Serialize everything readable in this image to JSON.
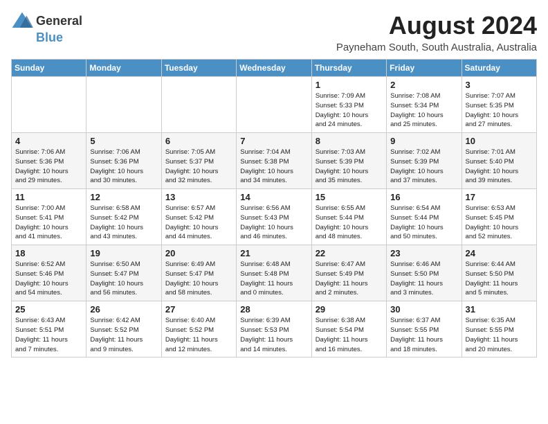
{
  "header": {
    "logo_general": "General",
    "logo_blue": "Blue",
    "month_title": "August 2024",
    "location": "Payneham South, South Australia, Australia"
  },
  "days_of_week": [
    "Sunday",
    "Monday",
    "Tuesday",
    "Wednesday",
    "Thursday",
    "Friday",
    "Saturday"
  ],
  "weeks": [
    [
      {
        "day": "",
        "info": ""
      },
      {
        "day": "",
        "info": ""
      },
      {
        "day": "",
        "info": ""
      },
      {
        "day": "",
        "info": ""
      },
      {
        "day": "1",
        "info": "Sunrise: 7:09 AM\nSunset: 5:33 PM\nDaylight: 10 hours\nand 24 minutes."
      },
      {
        "day": "2",
        "info": "Sunrise: 7:08 AM\nSunset: 5:34 PM\nDaylight: 10 hours\nand 25 minutes."
      },
      {
        "day": "3",
        "info": "Sunrise: 7:07 AM\nSunset: 5:35 PM\nDaylight: 10 hours\nand 27 minutes."
      }
    ],
    [
      {
        "day": "4",
        "info": "Sunrise: 7:06 AM\nSunset: 5:36 PM\nDaylight: 10 hours\nand 29 minutes."
      },
      {
        "day": "5",
        "info": "Sunrise: 7:06 AM\nSunset: 5:36 PM\nDaylight: 10 hours\nand 30 minutes."
      },
      {
        "day": "6",
        "info": "Sunrise: 7:05 AM\nSunset: 5:37 PM\nDaylight: 10 hours\nand 32 minutes."
      },
      {
        "day": "7",
        "info": "Sunrise: 7:04 AM\nSunset: 5:38 PM\nDaylight: 10 hours\nand 34 minutes."
      },
      {
        "day": "8",
        "info": "Sunrise: 7:03 AM\nSunset: 5:39 PM\nDaylight: 10 hours\nand 35 minutes."
      },
      {
        "day": "9",
        "info": "Sunrise: 7:02 AM\nSunset: 5:39 PM\nDaylight: 10 hours\nand 37 minutes."
      },
      {
        "day": "10",
        "info": "Sunrise: 7:01 AM\nSunset: 5:40 PM\nDaylight: 10 hours\nand 39 minutes."
      }
    ],
    [
      {
        "day": "11",
        "info": "Sunrise: 7:00 AM\nSunset: 5:41 PM\nDaylight: 10 hours\nand 41 minutes."
      },
      {
        "day": "12",
        "info": "Sunrise: 6:58 AM\nSunset: 5:42 PM\nDaylight: 10 hours\nand 43 minutes."
      },
      {
        "day": "13",
        "info": "Sunrise: 6:57 AM\nSunset: 5:42 PM\nDaylight: 10 hours\nand 44 minutes."
      },
      {
        "day": "14",
        "info": "Sunrise: 6:56 AM\nSunset: 5:43 PM\nDaylight: 10 hours\nand 46 minutes."
      },
      {
        "day": "15",
        "info": "Sunrise: 6:55 AM\nSunset: 5:44 PM\nDaylight: 10 hours\nand 48 minutes."
      },
      {
        "day": "16",
        "info": "Sunrise: 6:54 AM\nSunset: 5:44 PM\nDaylight: 10 hours\nand 50 minutes."
      },
      {
        "day": "17",
        "info": "Sunrise: 6:53 AM\nSunset: 5:45 PM\nDaylight: 10 hours\nand 52 minutes."
      }
    ],
    [
      {
        "day": "18",
        "info": "Sunrise: 6:52 AM\nSunset: 5:46 PM\nDaylight: 10 hours\nand 54 minutes."
      },
      {
        "day": "19",
        "info": "Sunrise: 6:50 AM\nSunset: 5:47 PM\nDaylight: 10 hours\nand 56 minutes."
      },
      {
        "day": "20",
        "info": "Sunrise: 6:49 AM\nSunset: 5:47 PM\nDaylight: 10 hours\nand 58 minutes."
      },
      {
        "day": "21",
        "info": "Sunrise: 6:48 AM\nSunset: 5:48 PM\nDaylight: 11 hours\nand 0 minutes."
      },
      {
        "day": "22",
        "info": "Sunrise: 6:47 AM\nSunset: 5:49 PM\nDaylight: 11 hours\nand 2 minutes."
      },
      {
        "day": "23",
        "info": "Sunrise: 6:46 AM\nSunset: 5:50 PM\nDaylight: 11 hours\nand 3 minutes."
      },
      {
        "day": "24",
        "info": "Sunrise: 6:44 AM\nSunset: 5:50 PM\nDaylight: 11 hours\nand 5 minutes."
      }
    ],
    [
      {
        "day": "25",
        "info": "Sunrise: 6:43 AM\nSunset: 5:51 PM\nDaylight: 11 hours\nand 7 minutes."
      },
      {
        "day": "26",
        "info": "Sunrise: 6:42 AM\nSunset: 5:52 PM\nDaylight: 11 hours\nand 9 minutes."
      },
      {
        "day": "27",
        "info": "Sunrise: 6:40 AM\nSunset: 5:52 PM\nDaylight: 11 hours\nand 12 minutes."
      },
      {
        "day": "28",
        "info": "Sunrise: 6:39 AM\nSunset: 5:53 PM\nDaylight: 11 hours\nand 14 minutes."
      },
      {
        "day": "29",
        "info": "Sunrise: 6:38 AM\nSunset: 5:54 PM\nDaylight: 11 hours\nand 16 minutes."
      },
      {
        "day": "30",
        "info": "Sunrise: 6:37 AM\nSunset: 5:55 PM\nDaylight: 11 hours\nand 18 minutes."
      },
      {
        "day": "31",
        "info": "Sunrise: 6:35 AM\nSunset: 5:55 PM\nDaylight: 11 hours\nand 20 minutes."
      }
    ]
  ]
}
